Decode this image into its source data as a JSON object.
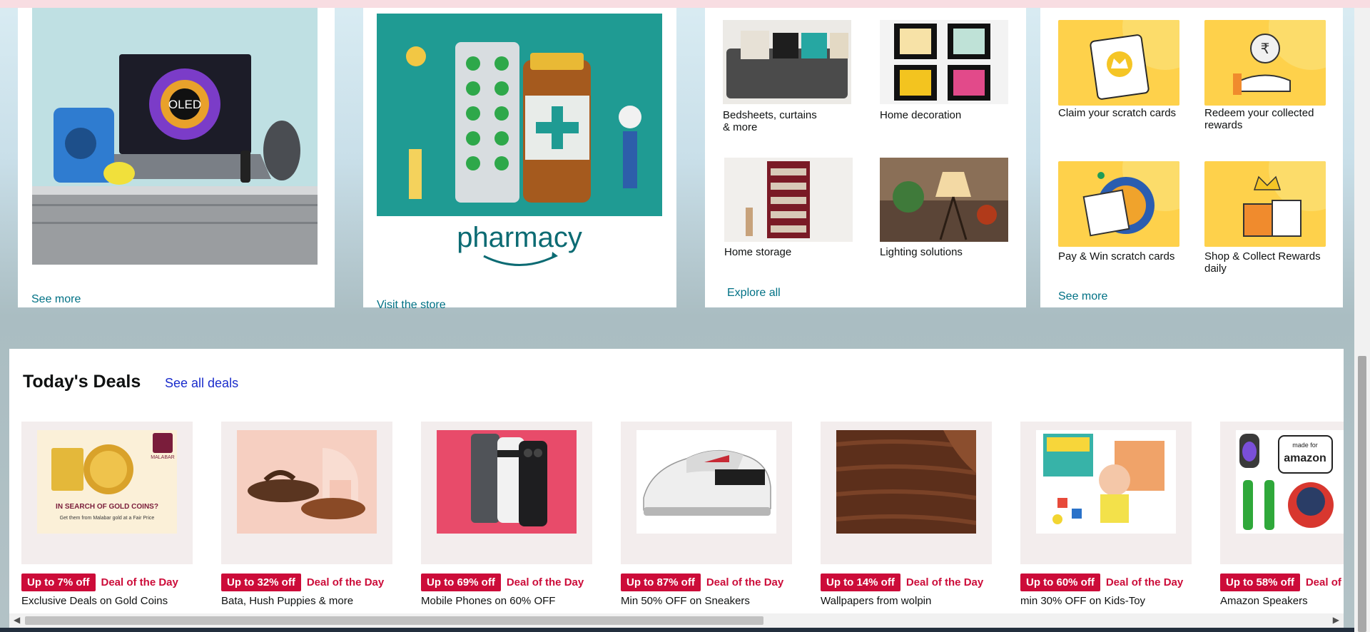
{
  "cards": {
    "electronics": {
      "link": "See more"
    },
    "pharmacy": {
      "brand": "pharmacy",
      "link": "Visit the store"
    },
    "home": {
      "items": [
        "Bedsheets, curtains & more",
        "Home decoration",
        "Home storage",
        "Lighting solutions"
      ],
      "link": "Explore all"
    },
    "rewards": {
      "items": [
        "Claim your scratch cards",
        "Redeem your collected rewards",
        "Pay & Win scratch cards",
        "Shop & Collect Rewards daily"
      ],
      "link": "See more"
    }
  },
  "deals": {
    "title": "Today's Deals",
    "see_all": "See all deals",
    "items": [
      {
        "badge": "Up to 7% off",
        "label": "Deal of the Day",
        "name": "Exclusive Deals on Gold Coins"
      },
      {
        "badge": "Up to 32% off",
        "label": "Deal of the Day",
        "name": "Bata, Hush Puppies & more"
      },
      {
        "badge": "Up to 69% off",
        "label": "Deal of the Day",
        "name": "Mobile Phones on 60% OFF"
      },
      {
        "badge": "Up to 87% off",
        "label": "Deal of the Day",
        "name": "Min 50% OFF on Sneakers"
      },
      {
        "badge": "Up to 14% off",
        "label": "Deal of the Day",
        "name": "Wallpapers from wolpin"
      },
      {
        "badge": "Up to 60% off",
        "label": "Deal of the Day",
        "name": "min 30% OFF on Kids-Toy"
      },
      {
        "badge": "Up to 58% off",
        "label": "Deal of the Day",
        "name": "Amazon Speakers"
      }
    ],
    "promo_text": {
      "gold": "IN SEARCH OF GOLD COINS?",
      "gold_sub": "Get them from Malabar gold at a Fair Price",
      "gold_brand": "MALABAR",
      "oled": "OLED",
      "amazon_made_for": "made for",
      "amazon": "amazon"
    }
  },
  "colors": {
    "accent": "#cc0c39",
    "link": "#007185",
    "deals_link": "#1a2ccc",
    "reward_bg": "#fed14b"
  }
}
